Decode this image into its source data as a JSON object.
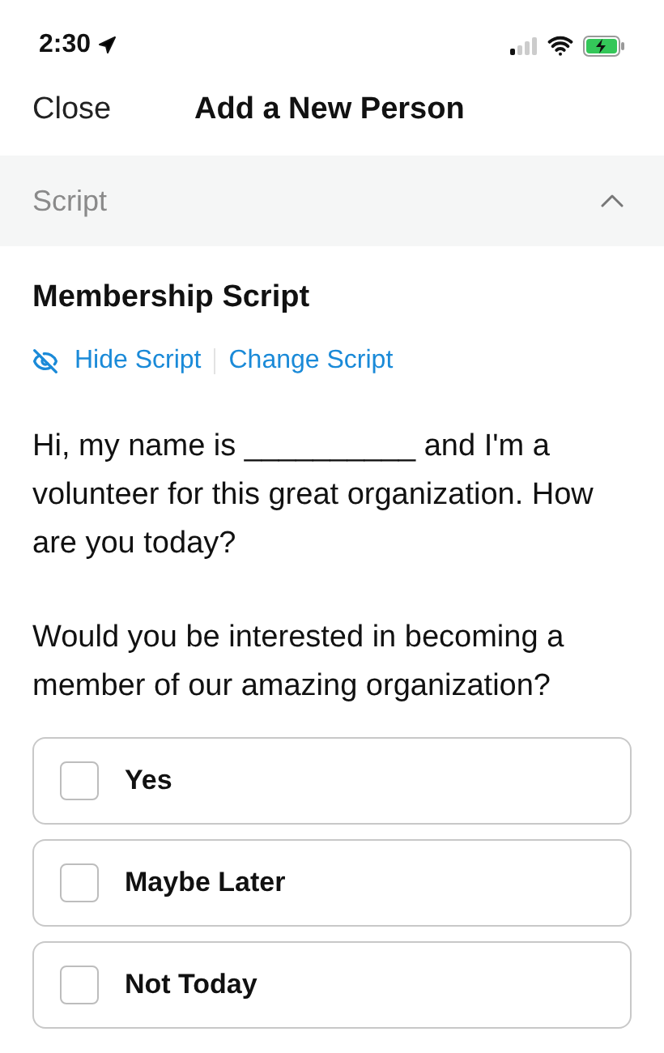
{
  "status_bar": {
    "time": "2:30"
  },
  "nav": {
    "close": "Close",
    "title": "Add a New Person"
  },
  "section": {
    "title": "Script",
    "expanded": true
  },
  "script": {
    "title": "Membership Script",
    "hide": "Hide Script",
    "change": "Change Script",
    "paragraphs": [
      "Hi, my name is __________ and I'm a volunteer for this great organization. How are you today?",
      "Would you be interested in becoming a member of our amazing organization?"
    ]
  },
  "options": [
    {
      "label": "Yes",
      "checked": false
    },
    {
      "label": "Maybe Later",
      "checked": false
    },
    {
      "label": "Not Today",
      "checked": false
    }
  ]
}
